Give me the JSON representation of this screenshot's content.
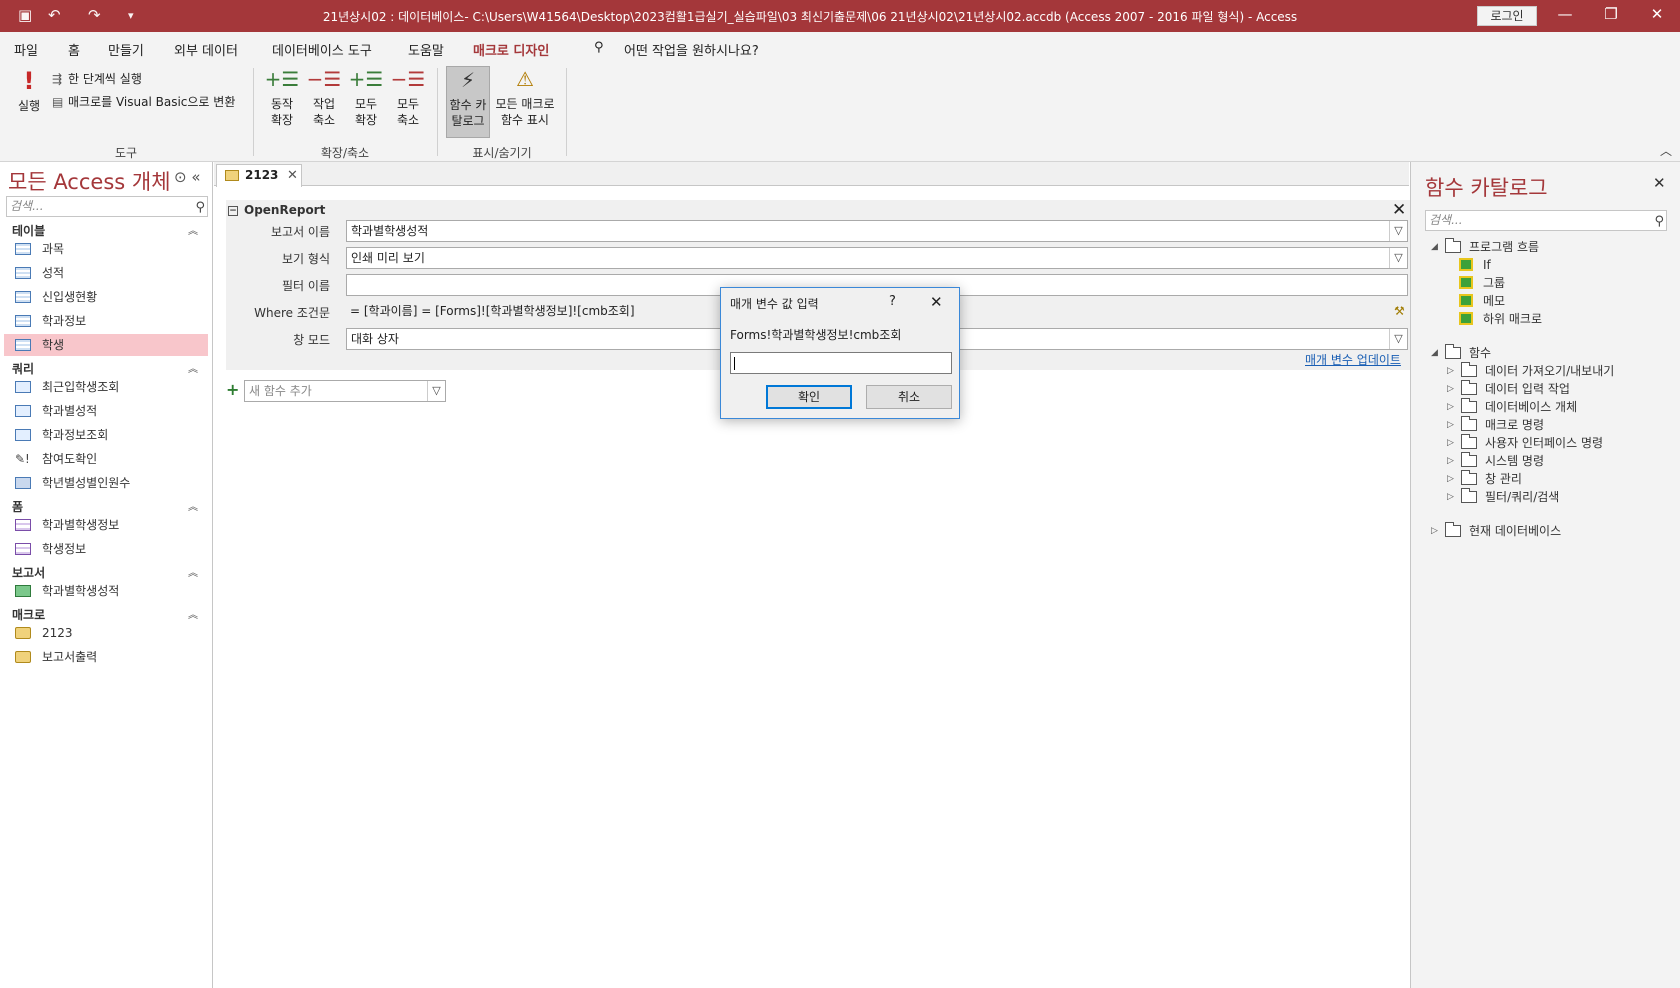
{
  "titlebar": {
    "title": "21년상시02 : 데이터베이스- C:\\Users\\W41564\\Desktop\\2023컴활1급실기_실습파일\\03 최신기출문제\\06 21년상시02\\21년상시02.accdb (Access 2007 - 2016 파일 형식)  -  Access",
    "login": "로그인",
    "save_icon": "▣",
    "undo_icon": "↶",
    "redo_icon": "↷",
    "customize_icon": "▾",
    "minimize_icon": "—",
    "restore_icon": "❐",
    "close_icon": "✕"
  },
  "menu": {
    "file": "파일",
    "home": "홈",
    "create": "만들기",
    "external": "외부 데이터",
    "dbtools": "데이터베이스 도구",
    "help": "도움말",
    "macro_design": "매크로 디자인",
    "tell_icon": "⚲",
    "tell": "어떤 작업을 원하시나요?"
  },
  "ribbon": {
    "run": "실행",
    "run_icon": "!",
    "single_step": "한 단계씩 실행",
    "convert_vb": "매크로를 Visual Basic으로 변환",
    "group_tools": "도구",
    "expand_action": [
      "동작",
      "확장"
    ],
    "collapse_action": [
      "작업",
      "축소"
    ],
    "expand_all": [
      "모두",
      "확장"
    ],
    "collapse_all": [
      "모두",
      "축소"
    ],
    "group_expand": "확장/축소",
    "func_catalog": [
      "함수 카",
      "탈로그"
    ],
    "show_all": [
      "모든 매크로",
      "함수 표시"
    ],
    "group_show": "표시/숨기기",
    "collapse_ribbon": "︿",
    "accent": "#a4373a"
  },
  "nav": {
    "title": "모든 Access 개체",
    "title_btns": "⊙ «",
    "search_placeholder": "검색...",
    "search_icon": "⚲",
    "chev": "︽",
    "sections": {
      "tables": "테이블",
      "queries": "쿼리",
      "forms": "폼",
      "reports": "보고서",
      "macros": "매크로"
    },
    "tables": [
      "과목",
      "성적",
      "신입생현황",
      "학과정보",
      "학생"
    ],
    "queries": [
      "최근입학생조회",
      "학과별성적",
      "학과정보조회",
      "참여도확인",
      "학년별성별인원수"
    ],
    "forms": [
      "학과별학생정보",
      "학생정보"
    ],
    "reports": [
      "학과별학생성적"
    ],
    "macros": [
      "2123",
      "보고서출력"
    ]
  },
  "doc": {
    "tab": "2123",
    "tab_close": "✕",
    "action": "OpenReport",
    "collapse_box": "−",
    "close_icon": "✕",
    "labels": {
      "report_name": "보고서 이름",
      "view": "보기 형식",
      "filter": "필터 이름",
      "where": "Where 조건문",
      "window": "창 모드"
    },
    "values": {
      "report_name": "학과별학생성적",
      "view": "인쇄 미리 보기",
      "filter": "",
      "where": "= [학과이름] = [Forms]![학과별학생정보]![cmb조회]",
      "window": "대화 상자"
    },
    "dropdown_icon": "▽",
    "builder_icon": "⚒",
    "update_params": "매개 변수 업데이트",
    "add_plus": "+",
    "add_new": "새 함수 추가"
  },
  "catalog": {
    "title": "함수 카탈로그",
    "close_icon": "✕",
    "search_placeholder": "검색...",
    "search_icon": "⚲",
    "expanded_icon": "◢",
    "collapsed_icon": "▷",
    "program_flow": "프로그램 흐름",
    "flow_items": [
      "If",
      "그룹",
      "메모",
      "하위 매크로"
    ],
    "functions": "함수",
    "func_items": [
      "데이터 가져오기/내보내기",
      "데이터 입력 작업",
      "데이터베이스 개체",
      "매크로 명령",
      "사용자 인터페이스 명령",
      "시스템 명령",
      "창 관리",
      "필터/쿼리/검색"
    ],
    "current_db": "현재 데이터베이스"
  },
  "dialog": {
    "title": "매개 변수 값 입력",
    "help_icon": "?",
    "close_icon": "✕",
    "prompt": "Forms!학과별학생정보!cmb조회",
    "value": "",
    "ok": "확인",
    "cancel": "취소"
  }
}
